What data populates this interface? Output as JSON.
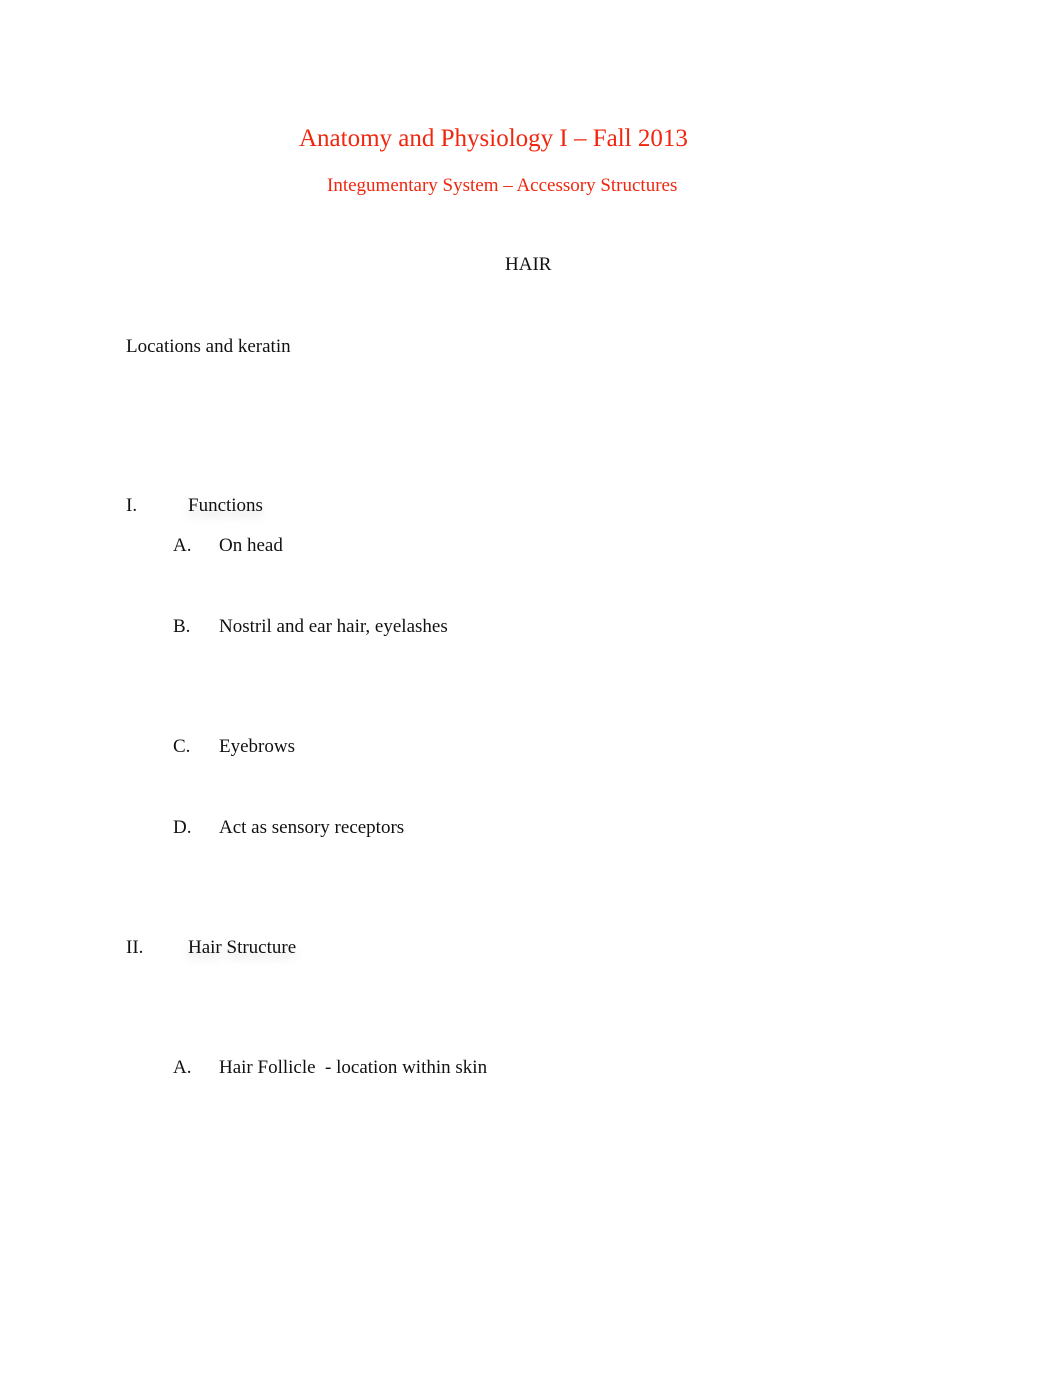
{
  "document": {
    "title": "Anatomy and Physiology I – Fall 2013",
    "subtitle": "Integumentary System – Accessory Structures",
    "section_title": "HAIR",
    "intro": "Locations and keratin",
    "sections": [
      {
        "number": "I.",
        "heading": "Functions",
        "items": [
          {
            "letter": "A.",
            "text": "On head"
          },
          {
            "letter": "B.",
            "text": "Nostril and ear hair, eyelashes"
          },
          {
            "letter": "C.",
            "text": "Eyebrows"
          },
          {
            "letter": "D.",
            "text": "Act as sensory receptors"
          }
        ]
      },
      {
        "number": "II.",
        "heading": "Hair Structure",
        "items": [
          {
            "letter": "A.",
            "text": "Hair Follicle  - location within skin"
          }
        ]
      }
    ]
  },
  "colors": {
    "title": "#f0260f",
    "body_text": "#111111"
  }
}
